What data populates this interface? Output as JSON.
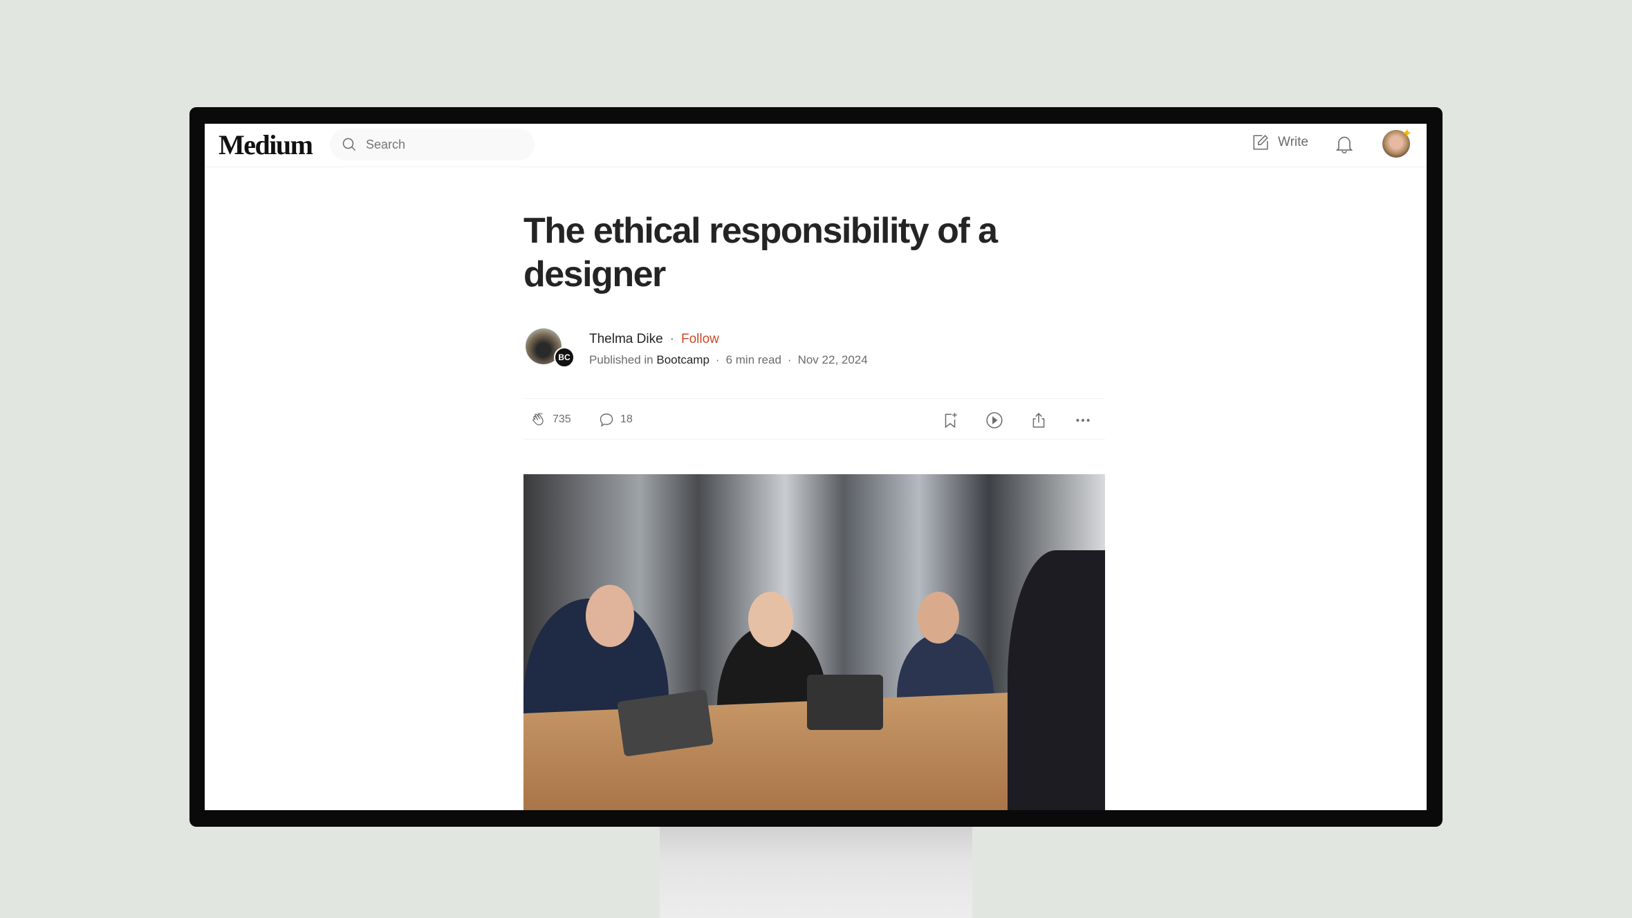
{
  "header": {
    "logo": "Medium",
    "search_placeholder": "Search",
    "write_label": "Write"
  },
  "article": {
    "title": "The ethical responsibility of a designer",
    "author": "Thelma Dike",
    "follow_label": "Follow",
    "published_in_label": "Published in",
    "publication": "Bootcamp",
    "publication_badge": "BC",
    "read_time": "6 min read",
    "date": "Nov 22, 2024",
    "claps": "735",
    "comments": "18"
  },
  "colors": {
    "follow": "#c94a29",
    "text": "#242424",
    "muted": "#6b6b6b",
    "background": "#e2e6e1"
  }
}
